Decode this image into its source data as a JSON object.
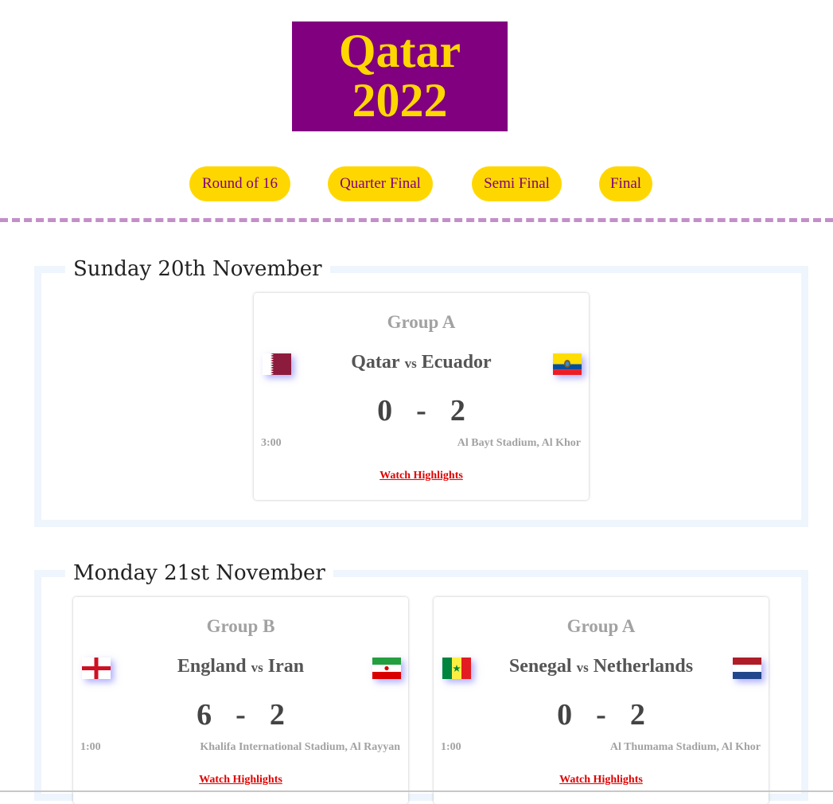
{
  "logo": {
    "line1": "Qatar",
    "line2": "2022"
  },
  "nav": [
    "Round of 16",
    "Quarter Final",
    "Semi Final",
    "Final"
  ],
  "days": [
    {
      "title": "Sunday 20th November",
      "matches": [
        {
          "group": "Group A",
          "home": "Qatar",
          "away": "Ecuador",
          "vs": "vs",
          "home_score": "0",
          "away_score": "2",
          "dash": "-",
          "time": "3:00",
          "venue": "Al Bayt Stadium, Al Khor",
          "highlights": "Watch Highlights",
          "home_flag": "qatar-flag",
          "away_flag": "ecuador-flag"
        }
      ]
    },
    {
      "title": "Monday 21st November",
      "matches": [
        {
          "group": "Group B",
          "home": "England",
          "away": "Iran",
          "vs": "vs",
          "home_score": "6",
          "away_score": "2",
          "dash": "-",
          "time": "1:00",
          "venue": "Khalifa International Stadium, Al Rayyan",
          "highlights": "Watch Highlights",
          "home_flag": "england-flag",
          "away_flag": "iran-flag"
        },
        {
          "group": "Group A",
          "home": "Senegal",
          "away": "Netherlands",
          "vs": "vs",
          "home_score": "0",
          "away_score": "2",
          "dash": "-",
          "time": "1:00",
          "venue": "Al Thumama Stadium, Al Khor",
          "highlights": "Watch Highlights",
          "home_flag": "senegal-flag",
          "away_flag": "netherlands-flag"
        }
      ]
    }
  ],
  "colors": {
    "purple": "#800080",
    "gold": "#ffd700",
    "link": "#e00000"
  }
}
